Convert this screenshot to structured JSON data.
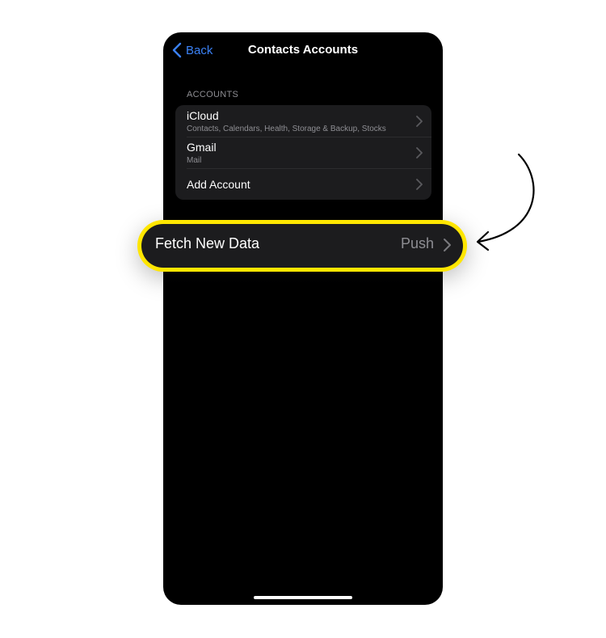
{
  "nav": {
    "back_label": "Back",
    "title": "Contacts Accounts"
  },
  "accounts": {
    "header": "ACCOUNTS",
    "items": [
      {
        "title": "iCloud",
        "subtitle": "Contacts, Calendars, Health, Storage & Backup, Stocks"
      },
      {
        "title": "Gmail",
        "subtitle": "Mail"
      },
      {
        "title": "Add Account"
      }
    ]
  },
  "fetch": {
    "label": "Fetch New Data",
    "value": "Push"
  },
  "colors": {
    "highlight": "#ffe600",
    "accent": "#3b82f6",
    "background": "#000000",
    "cell": "#1c1c1e"
  }
}
